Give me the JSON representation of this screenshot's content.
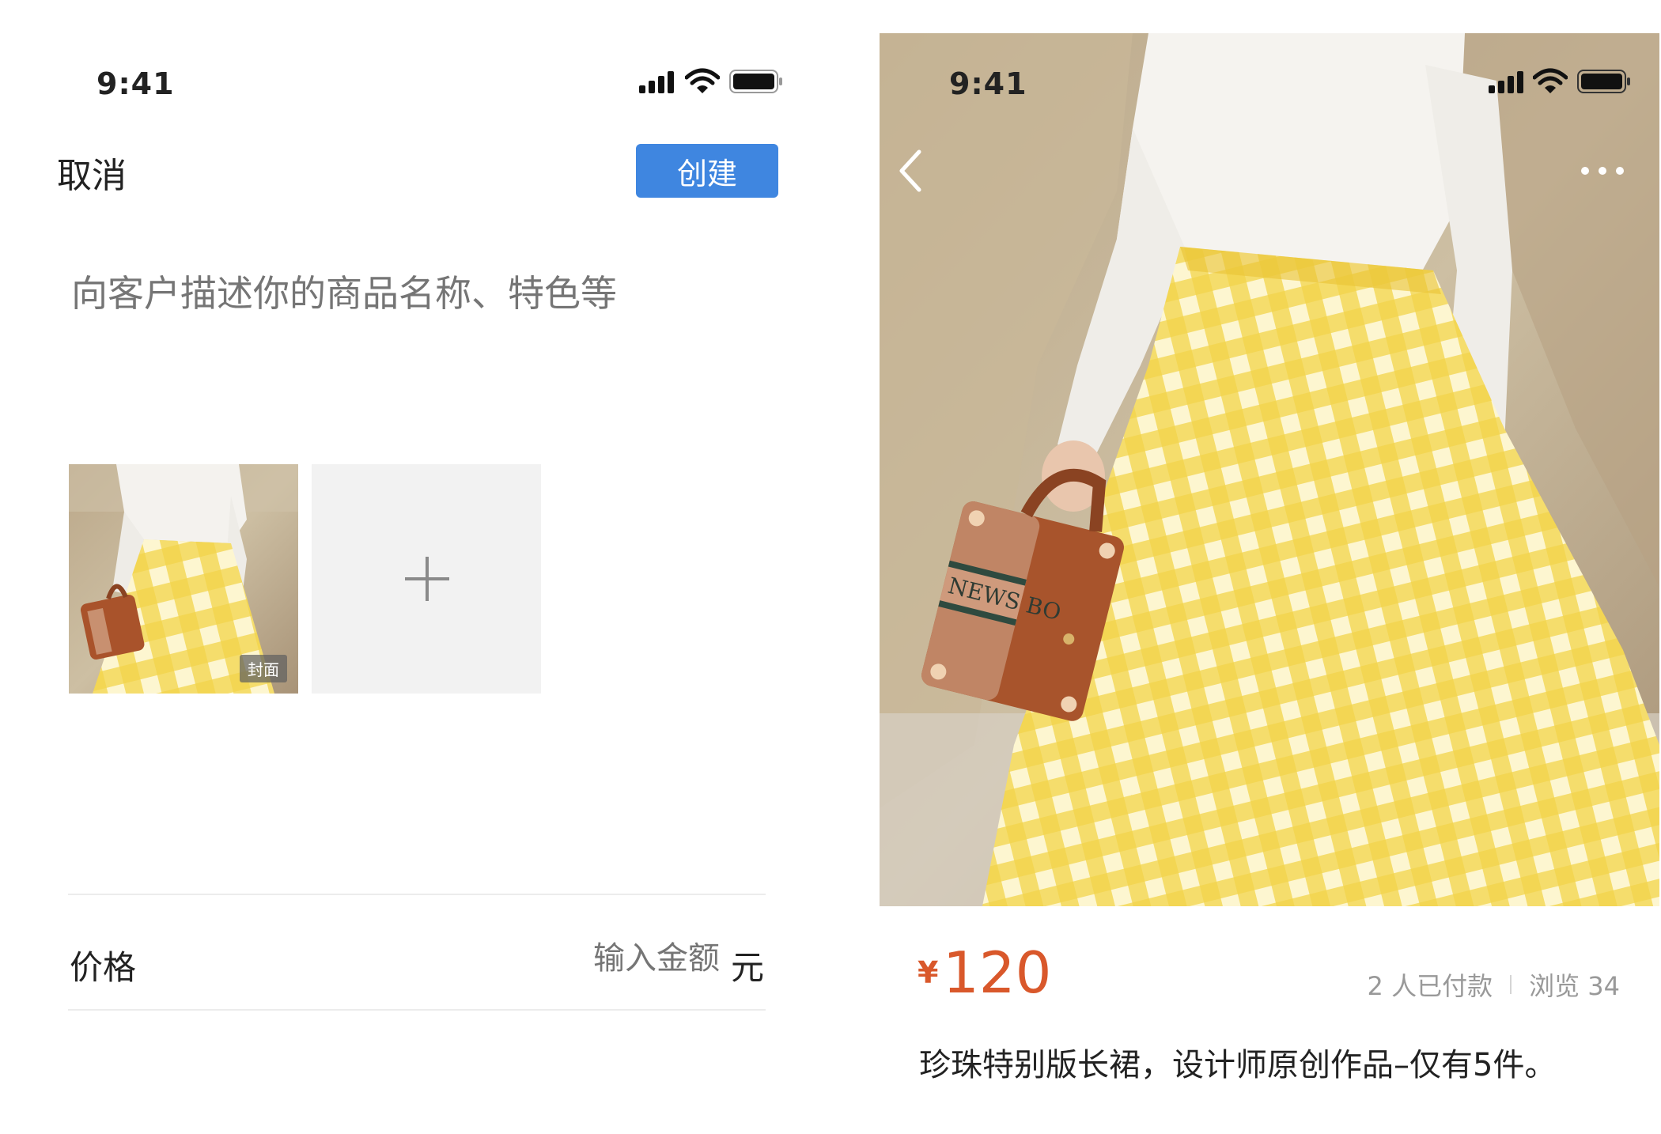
{
  "left_screen": {
    "status_time": "9:41",
    "cancel_label": "取消",
    "create_label": "创建",
    "description_placeholder": "向客户描述你的商品名称、特色等",
    "cover_badge": "封面",
    "price_label": "价格",
    "price_placeholder": "输入金额",
    "price_unit": "元"
  },
  "right_screen": {
    "status_time": "9:41",
    "currency_symbol": "¥",
    "price_value": "120",
    "paid_count": "2 人已付款",
    "views": "浏览 34",
    "product_title": "珍珠特别版长裙，设计师原创作品–仅有5件。",
    "bag_text": "NEWS BO"
  },
  "colors": {
    "accent_blue": "#3f86e0",
    "price_orange": "#d9582b",
    "skirt_yellow": "#f1cf3a"
  }
}
